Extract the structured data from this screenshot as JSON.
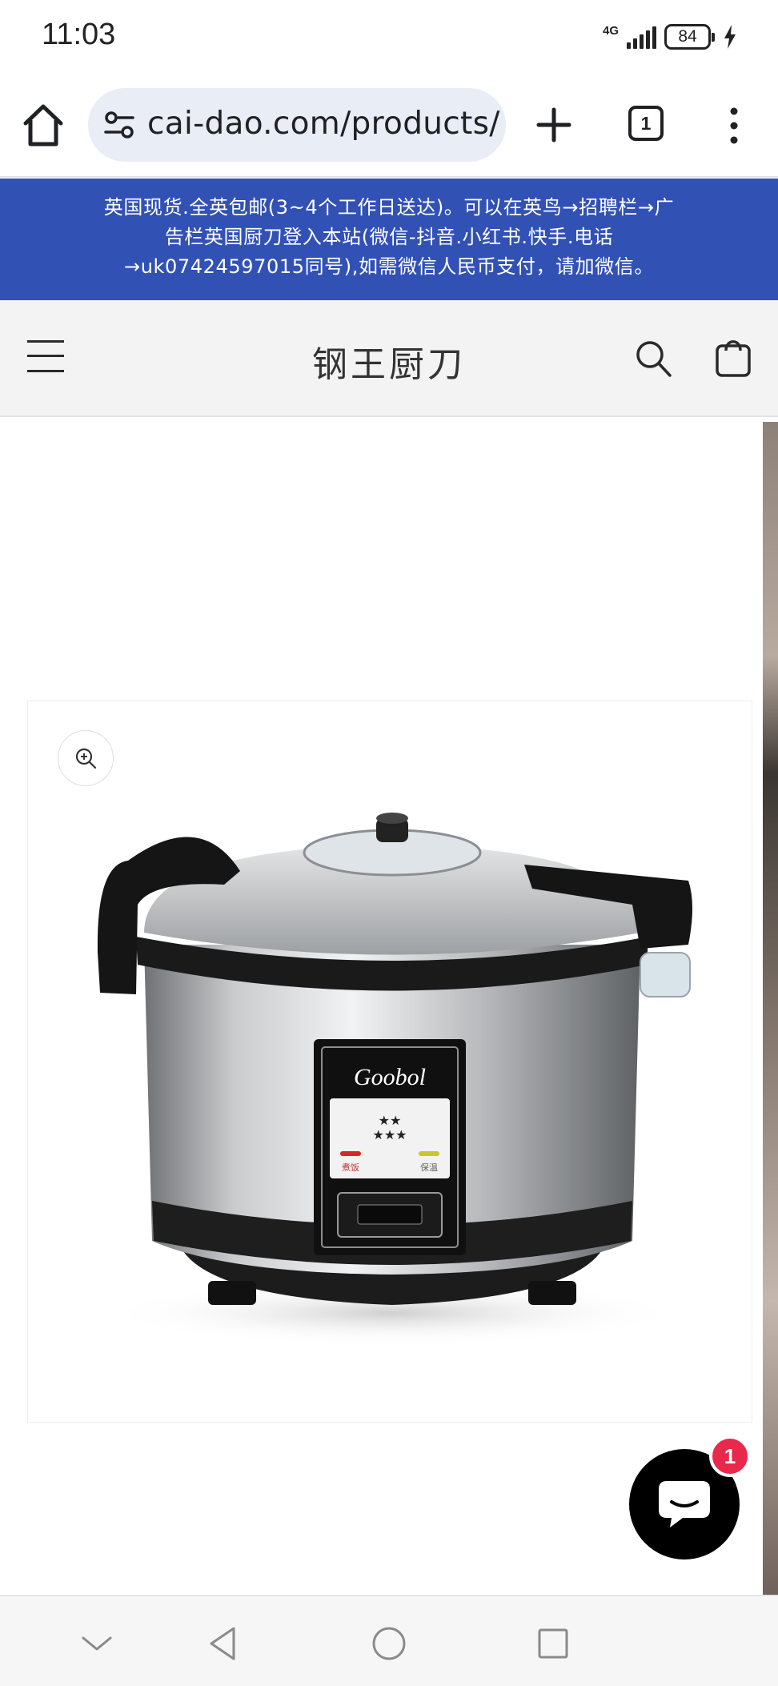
{
  "status_bar": {
    "time": "11:03",
    "network": "4G",
    "battery": "84",
    "icons": [
      "signal-icon",
      "battery-icon",
      "charging-bolt-icon"
    ]
  },
  "browser": {
    "url": "cai-dao.com/products/",
    "tab_count": "1",
    "icons": [
      "home-icon",
      "site-settings-icon",
      "new-tab-icon",
      "tab-switcher-icon",
      "more-menu-icon"
    ]
  },
  "announcement": {
    "line1": "英国现货.全英包邮(3~4个工作日送达)。可以在英鸟→招聘栏→广",
    "line2": "告栏英国厨刀登入本站(微信-抖音.小红书.快手.电话",
    "line3": "→uk07424597015同号),如需微信人民币支付，请加微信。",
    "background_color": "#3151b5"
  },
  "store_header": {
    "title": "钢王厨刀",
    "icons": [
      "menu-icon",
      "search-icon",
      "cart-icon"
    ]
  },
  "product": {
    "brand_mark": "Goobol",
    "panel_left_label": "煮饭",
    "panel_right_label": "保温",
    "zoom_icon": "zoom-in-icon"
  },
  "chat": {
    "badge_count": "1",
    "badge_color": "#e8294b",
    "icon": "chat-bubble-icon"
  },
  "nav_bar": {
    "icons": [
      "collapse-chevron-icon",
      "back-icon",
      "home-circle-icon",
      "recents-icon"
    ]
  }
}
